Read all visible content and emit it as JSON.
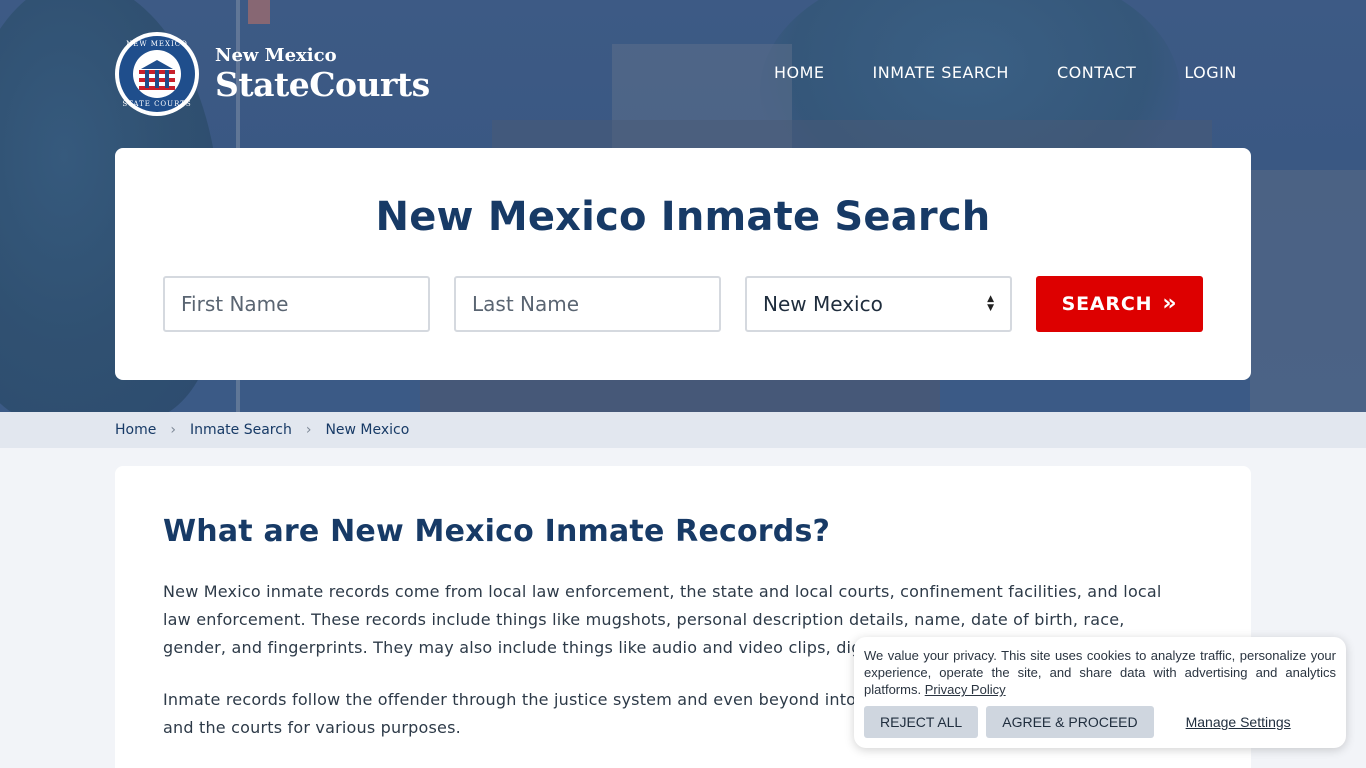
{
  "brand": {
    "seal_top_text": "NEW MEXICO",
    "seal_bottom_text": "STATE COURTS",
    "sub": "New Mexico",
    "main": "StateCourts"
  },
  "nav": {
    "items": [
      {
        "label": "HOME"
      },
      {
        "label": "INMATE SEARCH"
      },
      {
        "label": "CONTACT"
      },
      {
        "label": "LOGIN"
      }
    ]
  },
  "search": {
    "title": "New Mexico Inmate Search",
    "first_name_placeholder": "First Name",
    "last_name_placeholder": "Last Name",
    "state_value": "New Mexico",
    "button_label": "SEARCH",
    "button_icon": "double-chevron-right-icon"
  },
  "breadcrumb": {
    "items": [
      {
        "label": "Home"
      },
      {
        "label": "Inmate Search"
      },
      {
        "label": "New Mexico"
      }
    ]
  },
  "content": {
    "heading": "What are New Mexico Inmate Records?",
    "paragraph1": "New Mexico inmate records come from local law enforcement, the state and local courts, confinement facilities, and local law enforcement. These records include things like mugshots, personal description details, name, date of birth, race, gender, and fingerprints. They may also include things like audio and video clips, digital files, and pap",
    "paragraph2": "Inmate records follow the offender through the justice system and even beyond into par accessed by law enforcement and the courts for various purposes."
  },
  "cookie": {
    "message": "We value your privacy. This site uses cookies to analyze traffic, personalize your experience, operate the site, and share data with advertising and analytics platforms.",
    "privacy_link": "Privacy Policy",
    "reject_label": "REJECT ALL",
    "agree_label": "AGREE & PROCEED",
    "manage_label": "Manage Settings"
  },
  "colors": {
    "primary": "#173a66",
    "accent_red": "#dd0000",
    "breadcrumb_bg": "#e2e7ef",
    "page_bg": "#f2f4f8"
  }
}
